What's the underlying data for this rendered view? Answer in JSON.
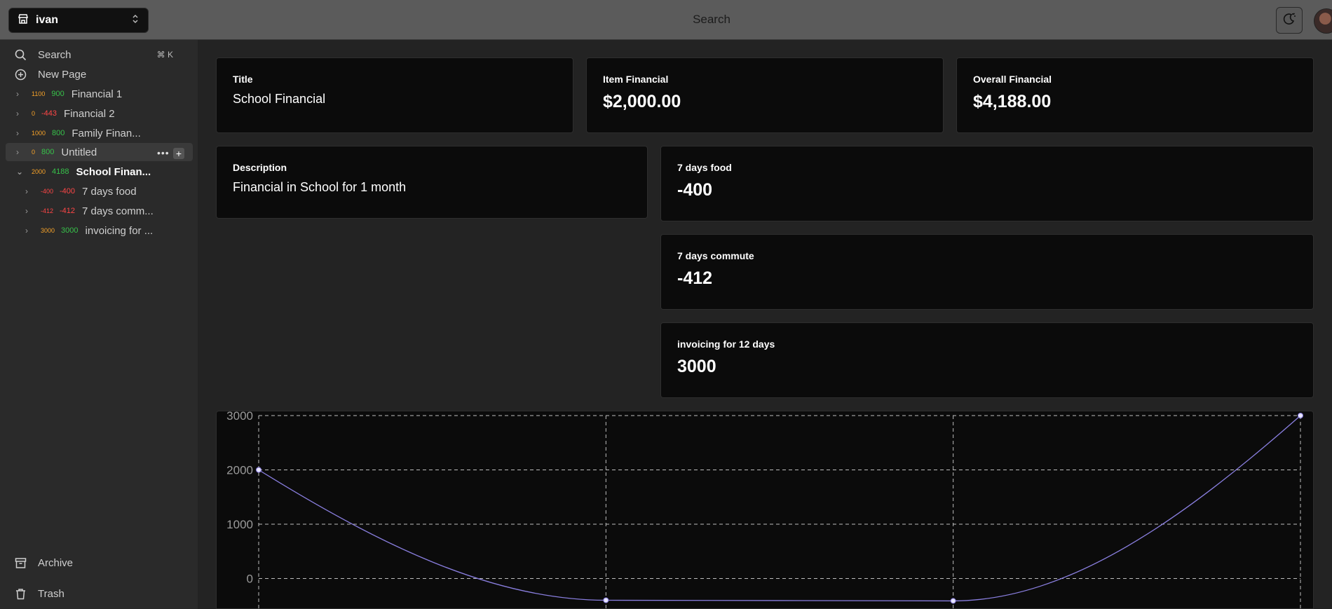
{
  "topbar": {
    "workspace_name": "ivan",
    "search_placeholder": "Search"
  },
  "sidebar": {
    "search_label": "Search",
    "search_shortcut": "⌘ K",
    "new_page_label": "New Page",
    "pages": [
      {
        "a": "1100",
        "b": "900",
        "title": "Financial 1",
        "a_color": "#f6a229",
        "b_color": "#37c24a"
      },
      {
        "a": "0",
        "b": "-443",
        "title": "Financial 2",
        "a_color": "#f6a229",
        "b_color": "#ff4646"
      },
      {
        "a": "1000",
        "b": "800",
        "title": "Family Finan...",
        "a_color": "#f6a229",
        "b_color": "#37c24a"
      },
      {
        "a": "0",
        "b": "800",
        "title": "Untitled",
        "a_color": "#f6a229",
        "b_color": "#37c24a"
      },
      {
        "a": "2000",
        "b": "4188",
        "title": "School Finan...",
        "a_color": "#f6a229",
        "b_color": "#37c24a"
      }
    ],
    "subpages": [
      {
        "a": "-400",
        "b": "-400",
        "title": "7 days food",
        "a_color": "#ff4646",
        "b_color": "#ff4646"
      },
      {
        "a": "-412",
        "b": "-412",
        "title": "7 days comm...",
        "a_color": "#ff4646",
        "b_color": "#ff4646"
      },
      {
        "a": "3000",
        "b": "3000",
        "title": "invoicing for ...",
        "a_color": "#f6a229",
        "b_color": "#37c24a"
      }
    ],
    "archive_label": "Archive",
    "trash_label": "Trash"
  },
  "main": {
    "title_card": {
      "label": "Title",
      "value": "School Financial"
    },
    "item_card": {
      "label": "Item Financial",
      "value": "$2,000.00"
    },
    "overall_card": {
      "label": "Overall Financial",
      "value": "$4,188.00"
    },
    "description_card": {
      "label": "Description",
      "value": "Financial in School for 1 month"
    },
    "entries": [
      {
        "label": "7 days food",
        "value": "-400"
      },
      {
        "label": "7 days commute",
        "value": "-412"
      },
      {
        "label": "invoicing for 12 days",
        "value": "3000"
      }
    ]
  },
  "chart_data": {
    "type": "line",
    "x": [
      0,
      1,
      2,
      3
    ],
    "values": [
      2000,
      -400,
      -412,
      3000
    ],
    "y_ticks": [
      "3000",
      "2000",
      "1000",
      "0"
    ],
    "ylim": [
      -600,
      3000
    ],
    "grid": true,
    "line_color": "#8a7fe0"
  }
}
